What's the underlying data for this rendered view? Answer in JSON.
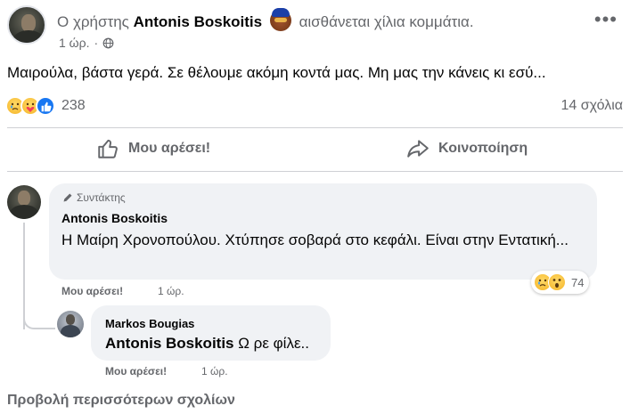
{
  "post": {
    "header_prefix": "Ο χρήστης",
    "author": "Antonis Boskoitis",
    "feeling_icon": "cool-face-emoji",
    "feeling_text": "αισθάνεται χίλια κομμάτια.",
    "time": "1 ώρ.",
    "separator": "·",
    "privacy_icon": "globe-icon",
    "text": "Μαιρούλα, βάστα γερά. Σε θέλουμε ακόμη κοντά μας. Μη μας την κάνεις κι εσύ...",
    "reaction_icons": [
      "sad-icon",
      "care-icon",
      "like-icon"
    ],
    "reaction_count": "238",
    "comments_count": "14 σχόλια"
  },
  "actions": {
    "like_label": "Μου αρέσει!",
    "share_label": "Κοινοποίηση"
  },
  "comments": [
    {
      "badge": "Συντάκτης",
      "author": "Antonis Boskoitis",
      "text": "Η Μαίρη Χρονοπούλου. Χτύπησε σοβαρά στο κεφάλι. Είναι στην Εντατική...",
      "reaction_icons": [
        "sad-icon",
        "wow-icon"
      ],
      "reaction_count": "74",
      "like_label": "Μου αρέσει!",
      "time": "1 ώρ."
    },
    {
      "author": "Markos Bougias",
      "tag": "Antonis Boskoitis",
      "text": "Ω ρε φίλε..",
      "like_label": "Μου αρέσει!",
      "time": "1 ώρ."
    }
  ],
  "view_more": "Προβολή περισσότερων σχολίων",
  "colors": {
    "accent": "#1877f2",
    "secondary_text": "#65676b",
    "bubble_bg": "#f0f2f5"
  }
}
